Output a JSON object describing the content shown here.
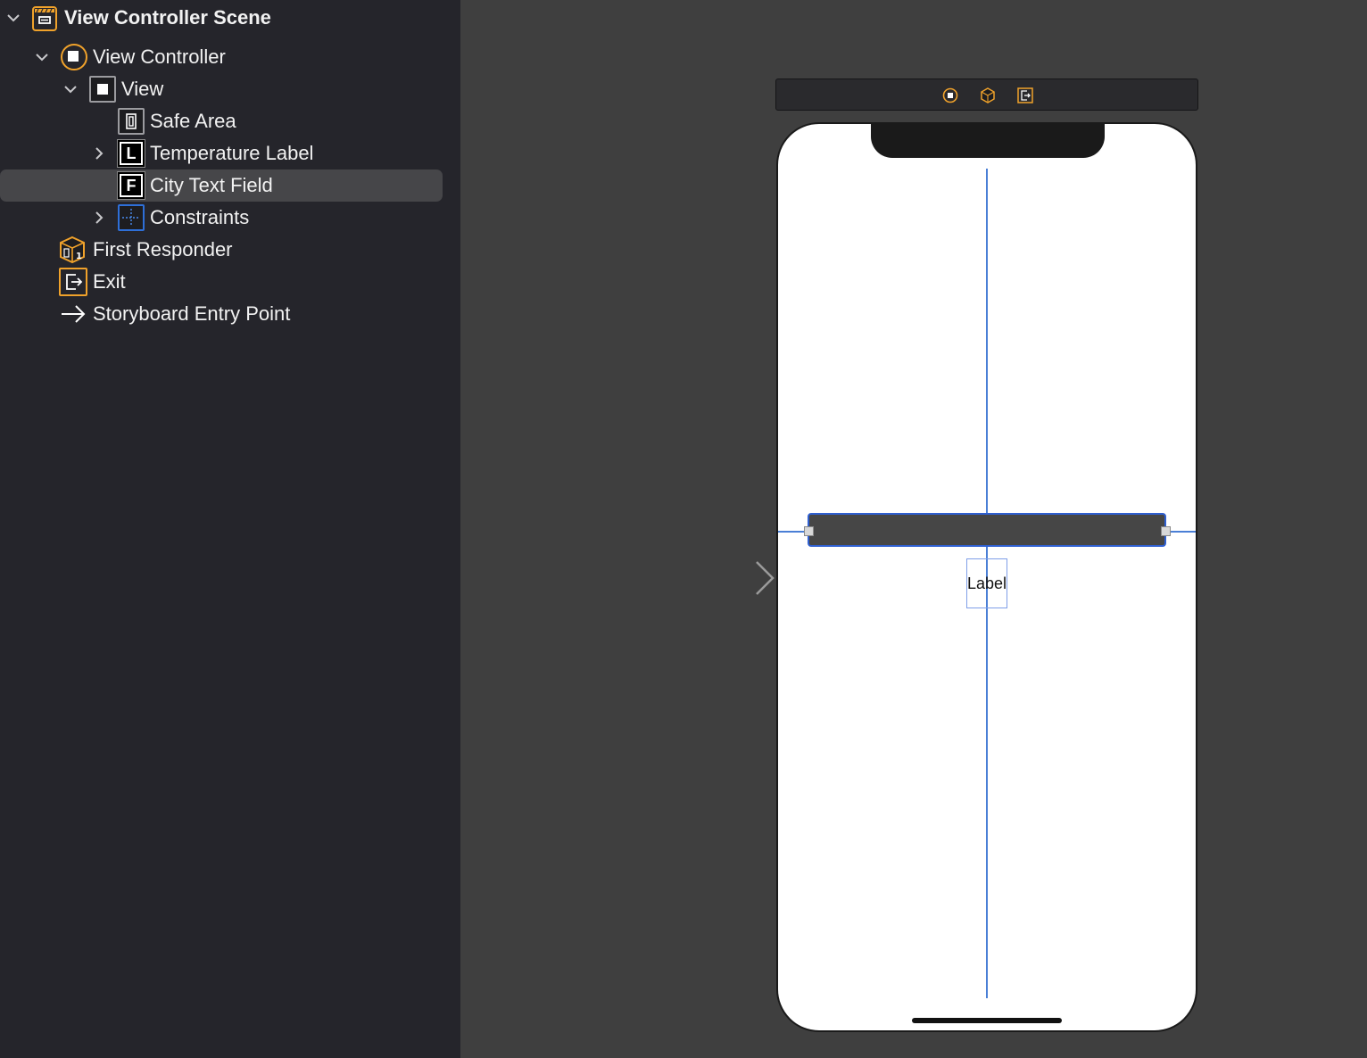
{
  "outline": {
    "items": [
      {
        "label": "View Controller Scene",
        "icon": "scene-icon",
        "chevron": "expanded"
      },
      {
        "label": "View Controller",
        "icon": "view-controller-icon",
        "chevron": "expanded"
      },
      {
        "label": "View",
        "icon": "view-icon",
        "chevron": "expanded"
      },
      {
        "label": "Safe Area",
        "icon": "safe-area-icon",
        "chevron": "none"
      },
      {
        "label": "Temperature Label",
        "icon": "label-icon",
        "icon_letter": "L",
        "chevron": "collapsed"
      },
      {
        "label": "City Text Field",
        "icon": "text-field-icon",
        "icon_letter": "F",
        "chevron": "none",
        "selected": true
      },
      {
        "label": "Constraints",
        "icon": "constraints-icon",
        "chevron": "collapsed"
      },
      {
        "label": "First Responder",
        "icon": "first-responder-icon",
        "chevron": "none"
      },
      {
        "label": "Exit",
        "icon": "exit-icon",
        "chevron": "none"
      },
      {
        "label": "Storyboard Entry Point",
        "icon": "arrow-right-icon",
        "chevron": "none"
      }
    ]
  },
  "canvas": {
    "label_text": "Label"
  },
  "colors": {
    "accent_orange": "#f0a22b",
    "constraint_blue": "#4a7fd6",
    "selection_bg": "#464649",
    "outline_bg": "#25252b",
    "canvas_bg": "#3f3f3f"
  }
}
